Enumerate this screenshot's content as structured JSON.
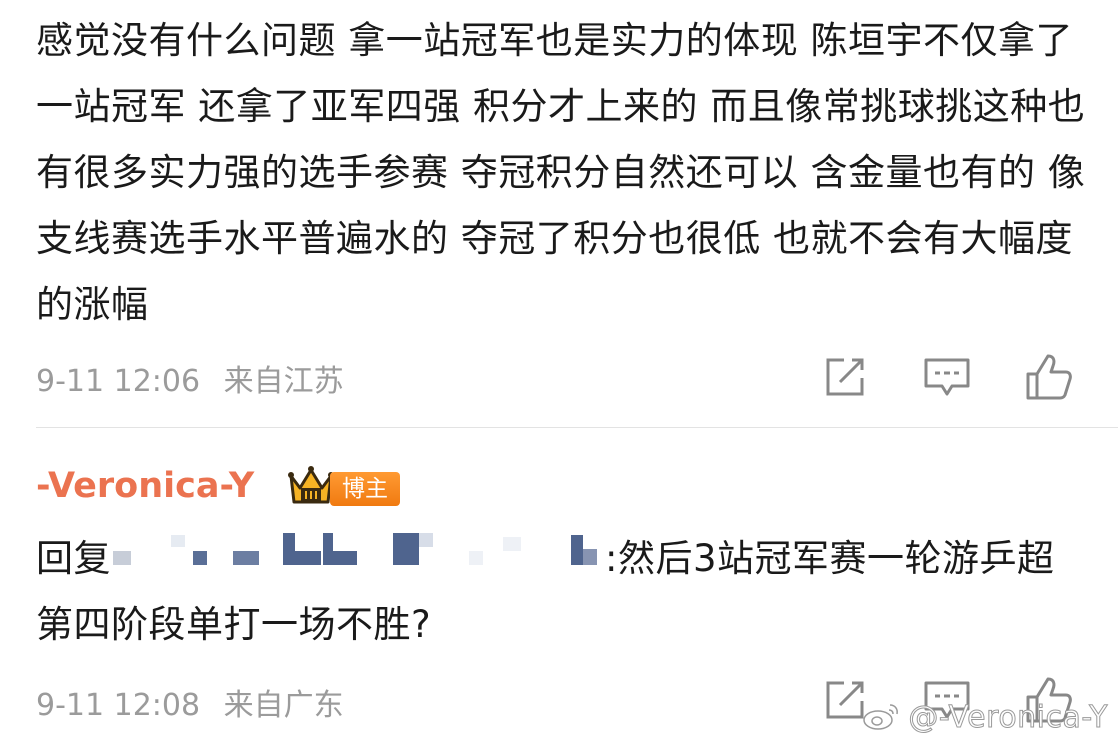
{
  "comments": [
    {
      "text": "感觉没有什么问题 拿一站冠军也是实力的体现 陈垣宇不仅拿了一站冠军 还拿了亚军四强 积分才上来的 而且像常挑球挑这种也有很多实力强的选手参赛 夺冠积分自然还可以 含金量也有的 像支线赛选手水平普遍水的 夺冠了积分也很低 也就不会有大幅度的涨幅",
      "time": "9-11 12:06",
      "source": "来自江苏"
    },
    {
      "username": "-Veronica-Y",
      "badge": "博主",
      "reply_prefix": "回复",
      "reply_text": ":然后3站冠军赛一轮游乒超第四阶段单打一场不胜?",
      "time": "9-11 12:08",
      "source": "来自广东"
    }
  ],
  "watermark": "@-Veronica-Y",
  "colors": {
    "username": "#eb7350",
    "meta": "#9b9b9b",
    "badge": "#f28a1f"
  },
  "icons": [
    "forward-icon",
    "reply-icon",
    "like-icon",
    "crown-icon",
    "weibo-logo-icon"
  ]
}
